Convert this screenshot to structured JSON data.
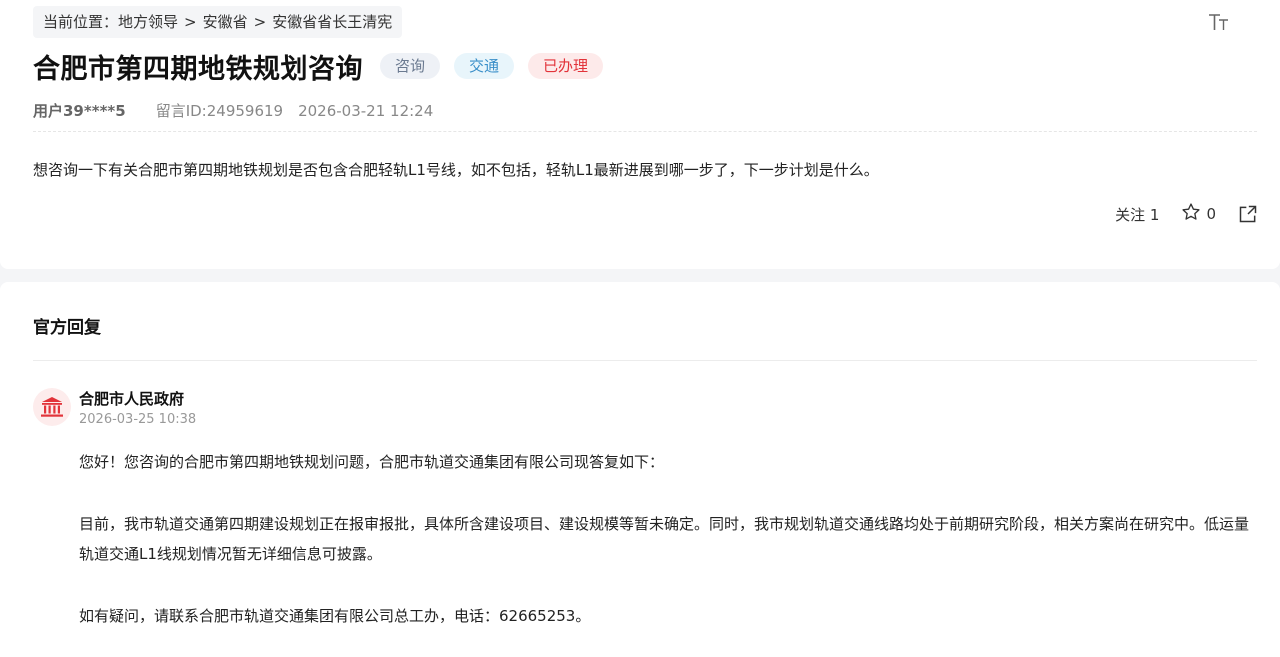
{
  "breadcrumb": {
    "prefix": "当前位置：",
    "items": [
      "地方领导",
      "安徽省",
      "安徽省省长王清宪"
    ],
    "separator": ">"
  },
  "toolbar": {
    "font_size_icon": "font-size-icon"
  },
  "message": {
    "title": "合肥市第四期地铁规划咨询",
    "tags": [
      {
        "label": "咨询",
        "bg": "#eef1f6",
        "color": "#6b7a90"
      },
      {
        "label": "交通",
        "bg": "#e8f5fb",
        "color": "#3a8fc9"
      },
      {
        "label": "已办理",
        "bg": "#fdeaea",
        "color": "#e2333a"
      }
    ],
    "user": "用户39****5",
    "message_id": "留言ID:24959619",
    "datetime": "2026-03-21 12:24",
    "content": "想咨询一下有关合肥市第四期地铁规划是否包含合肥轻轨L1号线，如不包括，轻轨L1最新进展到哪一步了，下一步计划是什么。",
    "follow_label": "关注 1",
    "star_count": "0",
    "star_icon": "star-outline-icon",
    "share_icon": "share-icon"
  },
  "reply": {
    "heading": "官方回复",
    "org": "合肥市人民政府",
    "org_icon": "government-building-icon",
    "datetime": "2026-03-25 10:38",
    "paragraphs": [
      "您好！您咨询的合肥市第四期地铁规划问题，合肥市轨道交通集团有限公司现答复如下：",
      "目前，我市轨道交通第四期建设规划正在报审报批，具体所含建设项目、建设规模等暂未确定。同时，我市规划轨道交通线路均处于前期研究阶段，相关方案尚在研究中。低运量轨道交通L1线规划情况暂无详细信息可披露。",
      "如有疑问，请联系合肥市轨道交通集团有限公司总工办，电话：62665253。"
    ]
  },
  "colors": {
    "accent_red": "#e2333a",
    "avatar_bg": "#fdecec",
    "page_bg": "#f4f5f7"
  }
}
